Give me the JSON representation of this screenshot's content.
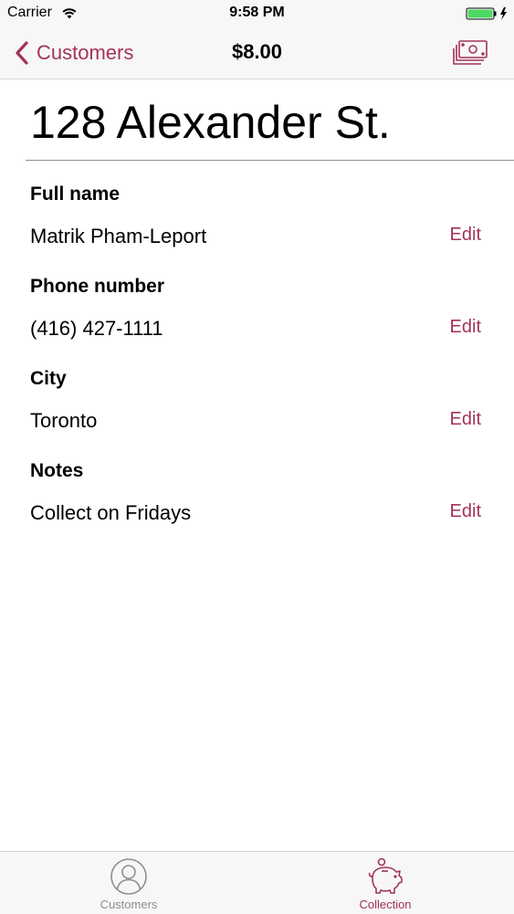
{
  "colors": {
    "accent": "#a3325b",
    "inactive_tab": "#8e8e93",
    "battery": "#4cd964"
  },
  "status_bar": {
    "carrier": "Carrier",
    "time": "9:58 PM",
    "icons": [
      "wifi-icon",
      "battery-icon",
      "charging-bolt-icon"
    ]
  },
  "nav": {
    "back_label": "Customers",
    "title": "$8.00",
    "right_icon": "cash-stack-icon"
  },
  "customer": {
    "address": "128 Alexander St.",
    "fields": [
      {
        "label": "Full name",
        "value": "Matrik Pham-Leport",
        "action": "Edit"
      },
      {
        "label": "Phone number",
        "value": "(416) 427-1111",
        "action": "Edit"
      },
      {
        "label": "City",
        "value": "Toronto",
        "action": "Edit"
      },
      {
        "label": "Notes",
        "value": "Collect on Fridays",
        "action": "Edit"
      }
    ]
  },
  "tab_bar": {
    "tabs": [
      {
        "label": "Customers",
        "icon": "person-icon",
        "selected": false
      },
      {
        "label": "Collection",
        "icon": "piggy-bank-icon",
        "selected": true
      }
    ]
  }
}
